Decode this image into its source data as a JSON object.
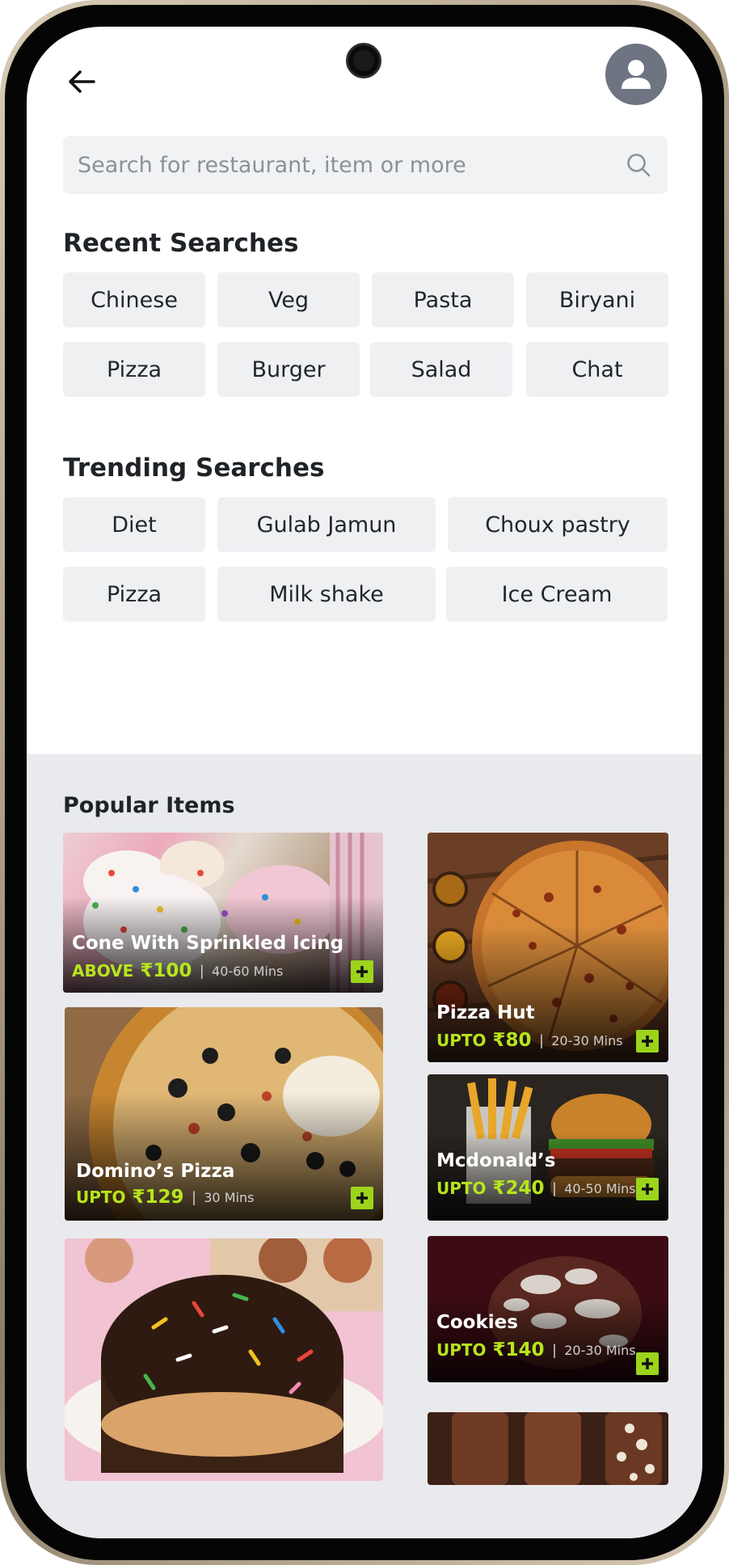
{
  "search": {
    "placeholder": "Search for restaurant, item or more"
  },
  "recent": {
    "title": "Recent Searches",
    "chips": [
      "Chinese",
      "Veg",
      "Pasta",
      "Biryani",
      "Pizza",
      "Burger",
      "Salad",
      "Chat"
    ]
  },
  "trending": {
    "title": "Trending Searches",
    "chips": [
      "Diet",
      "Gulab Jamun",
      "Choux pastry",
      "Pizza",
      "Milk shake",
      "Ice Cream"
    ]
  },
  "popular": {
    "title": "Popular Items",
    "items": [
      {
        "name": "Cone With Sprinkled Icing",
        "price_label": "ABOVE",
        "price": "₹100",
        "time": "40-60 Mins"
      },
      {
        "name": "Pizza Hut",
        "price_label": "UPTO",
        "price": "₹80",
        "time": "20-30 Mins"
      },
      {
        "name": "Domino’s Pizza",
        "price_label": "UPTO",
        "price": "₹129",
        "time": "30 Mins"
      },
      {
        "name": "Mcdonald’s",
        "price_label": "UPTO",
        "price": "₹240",
        "time": "40-50 Mins"
      },
      {
        "name": "Cookies",
        "price_label": "UPTO",
        "price": "₹140",
        "time": "20-30 Mins"
      }
    ]
  },
  "colors": {
    "accent": "#9bd41b",
    "price": "#b6e51c",
    "avatar": "#6e7481",
    "chip": "#eff0f2"
  },
  "icons": {
    "back": "arrow-left-icon",
    "avatar": "user-icon",
    "search": "search-icon",
    "add": "plus-icon"
  }
}
